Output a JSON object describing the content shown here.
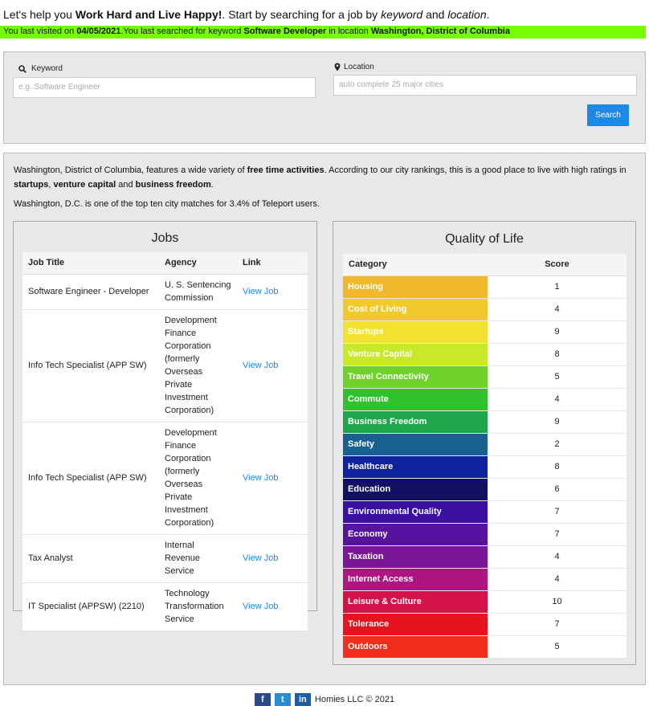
{
  "intro": {
    "t1": "Let's help you ",
    "b1": "Work Hard and Live Happy!",
    "t2": ". Start by searching for a job by ",
    "i1": "keyword",
    "t3": " and ",
    "i2": "location",
    "t4": "."
  },
  "visit": {
    "t1": "You last visited on ",
    "date": "04/05/2021",
    "t2": ".You last searched for keyword ",
    "keyword": "Software Developer",
    "t3": " in location ",
    "location": "Washington, District of Columbia"
  },
  "search": {
    "keyword_label": "Keyword",
    "keyword_placeholder": "e.g. Software Engineer",
    "location_label": "Location",
    "location_placeholder": "auto complete 25 major cities",
    "button": "Search"
  },
  "summary": {
    "p1_t1": "Washington, District of Columbia, features a wide variety of ",
    "p1_b1": "free time activities",
    "p1_t2": ". According to our city rankings, this is a good place to live with high ratings in",
    "p1_b2": "startups",
    "p1_t3": ", ",
    "p1_b3": "venture capital",
    "p1_t4": " and ",
    "p1_b4": "business freedom",
    "p1_t5": ".",
    "p2": "Washington, D.C. is one of the top ten city matches for 3.4% of Teleport users."
  },
  "jobs": {
    "title": "Jobs",
    "headers": [
      "Job Title",
      "Agency",
      "Link"
    ],
    "rows": [
      {
        "title": "Software Engineer - Developer",
        "agency": "U. S. Sentencing Commission",
        "link": "View Job"
      },
      {
        "title": "Info Tech Specialist (APP SW)",
        "agency": "Development Finance Corporation (formerly Overseas Private Investment Corporation)",
        "link": "View Job"
      },
      {
        "title": "Info Tech Specialist (APP SW)",
        "agency": "Development Finance Corporation (formerly Overseas Private Investment Corporation)",
        "link": "View Job"
      },
      {
        "title": "Tax Analyst",
        "agency": "Internal Revenue Service",
        "link": "View Job"
      },
      {
        "title": "IT Specialist (APPSW) (2210)",
        "agency": "Technology Transformation Service",
        "link": "View Job"
      }
    ]
  },
  "qol": {
    "title": "Quality of Life",
    "headers": [
      "Category",
      "Score"
    ],
    "rows": [
      {
        "category": "Housing",
        "score": "1",
        "color": "#f0b82c"
      },
      {
        "category": "Cost of Living",
        "score": "4",
        "color": "#f2c92c"
      },
      {
        "category": "Startups",
        "score": "9",
        "color": "#f2e42e"
      },
      {
        "category": "Venture Capital",
        "score": "8",
        "color": "#c9e82b"
      },
      {
        "category": "Travel Connectivity",
        "score": "5",
        "color": "#6ed22b"
      },
      {
        "category": "Commute",
        "score": "4",
        "color": "#2fc22b"
      },
      {
        "category": "Business Freedom",
        "score": "9",
        "color": "#1fa64a"
      },
      {
        "category": "Safety",
        "score": "2",
        "color": "#176090"
      },
      {
        "category": "Healthcare",
        "score": "8",
        "color": "#0e22a0"
      },
      {
        "category": "Education",
        "score": "6",
        "color": "#121063"
      },
      {
        "category": "Environmental Quality",
        "score": "7",
        "color": "#3b10a3"
      },
      {
        "category": "Economy",
        "score": "7",
        "color": "#56139f"
      },
      {
        "category": "Taxation",
        "score": "4",
        "color": "#7d1599"
      },
      {
        "category": "Internet Access",
        "score": "4",
        "color": "#ae1580"
      },
      {
        "category": "Leisure & Culture",
        "score": "10",
        "color": "#d4124a"
      },
      {
        "category": "Tolerance",
        "score": "7",
        "color": "#e8121f"
      },
      {
        "category": "Outdoors",
        "score": "5",
        "color": "#f02e1a"
      }
    ]
  },
  "footer": {
    "facebook": "f",
    "twitter": "t",
    "linkedin": "in",
    "copyright": "Homies LLC © 2021"
  }
}
